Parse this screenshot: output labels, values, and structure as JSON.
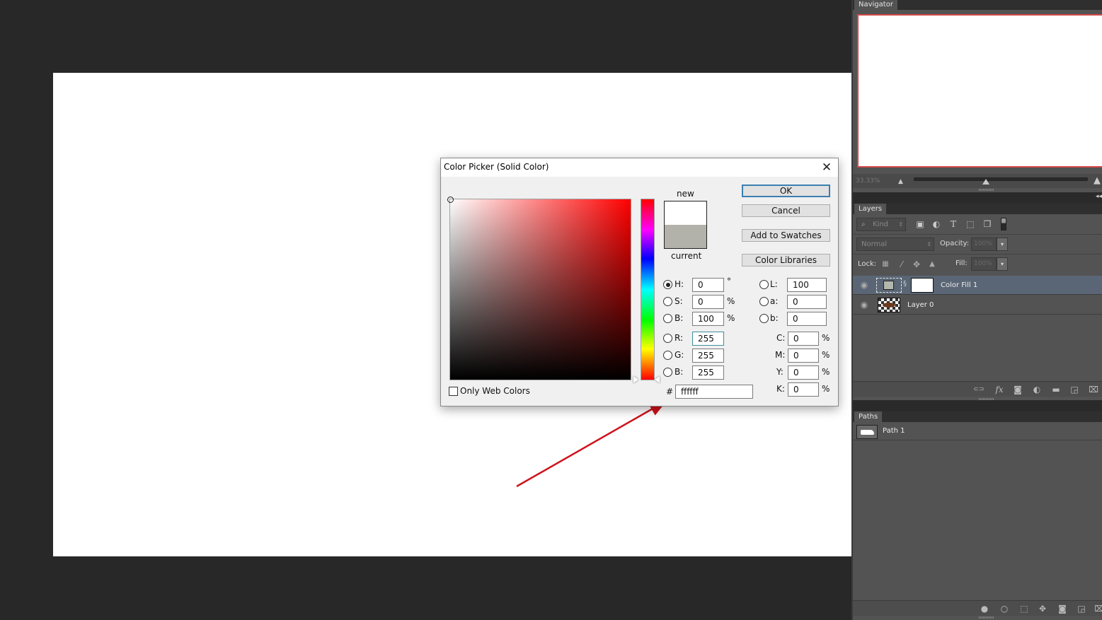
{
  "dialog": {
    "title": "Color Picker (Solid Color)",
    "close_glyph": "✕",
    "label_new": "new",
    "label_current": "current",
    "new_color": "#ffffff",
    "current_color": "#b3b2aa",
    "buttons": {
      "ok": "OK",
      "cancel": "Cancel",
      "add_to_swatches": "Add to Swatches",
      "color_libraries": "Color Libraries"
    },
    "hsb": {
      "h": {
        "label": "H:",
        "value": "0",
        "unit": "°",
        "selected": true
      },
      "s": {
        "label": "S:",
        "value": "0",
        "unit": "%"
      },
      "b": {
        "label": "B:",
        "value": "100",
        "unit": "%"
      }
    },
    "rgb": {
      "r": {
        "label": "R:",
        "value": "255"
      },
      "g": {
        "label": "G:",
        "value": "255"
      },
      "b": {
        "label": "B:",
        "value": "255"
      }
    },
    "lab": {
      "l": {
        "label": "L:",
        "value": "100"
      },
      "a": {
        "label": "a:",
        "value": "0"
      },
      "b": {
        "label": "b:",
        "value": "0"
      }
    },
    "cmyk": {
      "c": {
        "label": "C:",
        "value": "0",
        "unit": "%"
      },
      "m": {
        "label": "M:",
        "value": "0",
        "unit": "%"
      },
      "y": {
        "label": "Y:",
        "value": "0",
        "unit": "%"
      },
      "k": {
        "label": "K:",
        "value": "0",
        "unit": "%"
      }
    },
    "hex_label": "#",
    "hex_value": "ffffff",
    "only_web_colors": "Only Web Colors"
  },
  "navigator": {
    "tab": "Navigator",
    "zoom": "33.33%"
  },
  "layers": {
    "tab": "Layers",
    "filter_kind": "Kind",
    "blend_mode": "Normal",
    "opacity_label": "Opacity:",
    "opacity_value": "100%",
    "lock_label": "Lock:",
    "fill_label": "Fill:",
    "fill_value": "100%",
    "items": [
      {
        "name": "Color Fill 1",
        "selected": true
      },
      {
        "name": "Layer 0",
        "selected": false
      }
    ]
  },
  "paths": {
    "tab": "Paths",
    "items": [
      {
        "name": "Path 1"
      }
    ]
  },
  "icons": {
    "search": "⌕",
    "updown": "⇕",
    "eye": "◉",
    "type": "T",
    "lock": "🔒",
    "move": "✥",
    "brush": "⁄",
    "fx": "fx",
    "trash": "🗑",
    "folder": "▬",
    "link": "⊂⊃",
    "dropdown": "▾"
  },
  "colors": {
    "accent_blue": "#3c7fb1",
    "arrow_red": "#d0121b",
    "nav_frame": "#d24a4a"
  }
}
